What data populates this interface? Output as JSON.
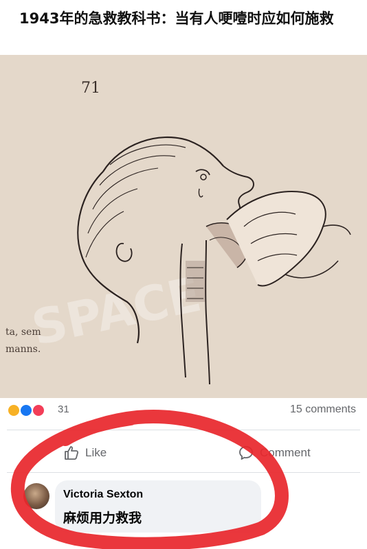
{
  "post": {
    "title": "1943年的急救教科书：当有人哽噎时应如何施救"
  },
  "image": {
    "page_number": "71",
    "side_text_line1": "ta,  sem",
    "side_text_line2": "manns."
  },
  "reactions": {
    "icons": [
      "haha-reaction-icon",
      "like-reaction-icon",
      "love-reaction-icon"
    ],
    "count": "31",
    "comments_count": "15 comments"
  },
  "actions": {
    "like_label": "Like",
    "comment_label": "Comment"
  },
  "comment": {
    "author": "Victoria Sexton",
    "text": "麻烦用力救我"
  },
  "colors": {
    "annotation_red": "#e8262b",
    "paper": "#e9ddd0",
    "facebook_blue": "#1877f2",
    "love_red": "#f33e58",
    "haha_yellow": "#f7b125"
  }
}
